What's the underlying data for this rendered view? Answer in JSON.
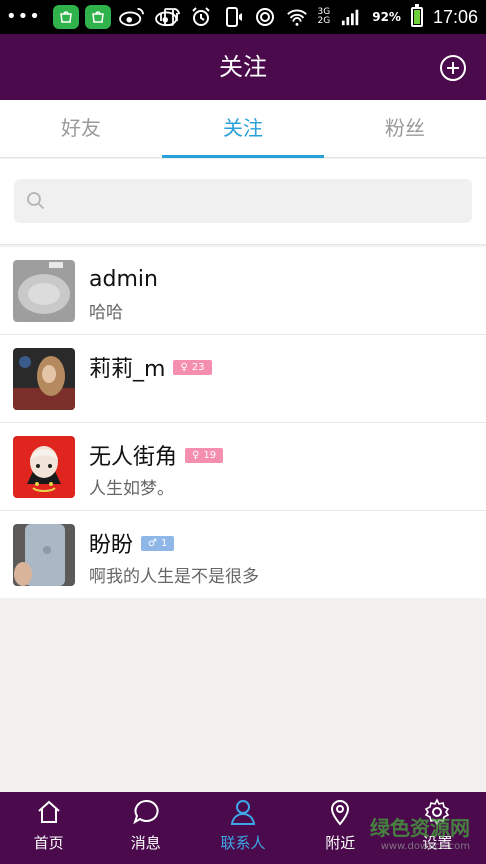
{
  "status_bar": {
    "dots": "•••",
    "network": "3G",
    "signal_label": "2G",
    "battery_percent": "92%",
    "time": "17:06"
  },
  "header": {
    "title": "关注"
  },
  "tabs": [
    {
      "label": "好友",
      "active": false
    },
    {
      "label": "关注",
      "active": true
    },
    {
      "label": "粉丝",
      "active": false
    }
  ],
  "search": {
    "placeholder": ""
  },
  "contacts": [
    {
      "name": "admin",
      "subtitle": "哈哈",
      "badge": null
    },
    {
      "name": "莉莉_m",
      "subtitle": "",
      "badge": {
        "gender": "female",
        "symbol": "♀",
        "age": "23"
      }
    },
    {
      "name": "无人街角",
      "subtitle": "人生如梦。",
      "badge": {
        "gender": "female",
        "symbol": "♀",
        "age": "19"
      }
    },
    {
      "name": "盼盼",
      "subtitle": "啊我的人生是不是很多",
      "badge": {
        "gender": "male",
        "symbol": "♂",
        "age": "1"
      }
    }
  ],
  "bottom_nav": [
    {
      "label": "首页",
      "icon": "home-icon",
      "active": false
    },
    {
      "label": "消息",
      "icon": "message-icon",
      "active": false
    },
    {
      "label": "联系人",
      "icon": "contacts-icon",
      "active": true
    },
    {
      "label": "附近",
      "icon": "location-icon",
      "active": false
    },
    {
      "label": "设置",
      "icon": "settings-icon",
      "active": false
    }
  ],
  "watermark": {
    "text": "绿色资源网",
    "url": "www.downcc.com"
  },
  "colors": {
    "brand_purple": "#4a0a4c",
    "accent_blue": "#2aa0d8",
    "female_badge": "#f58fb0",
    "male_badge": "#8eb7e8"
  }
}
